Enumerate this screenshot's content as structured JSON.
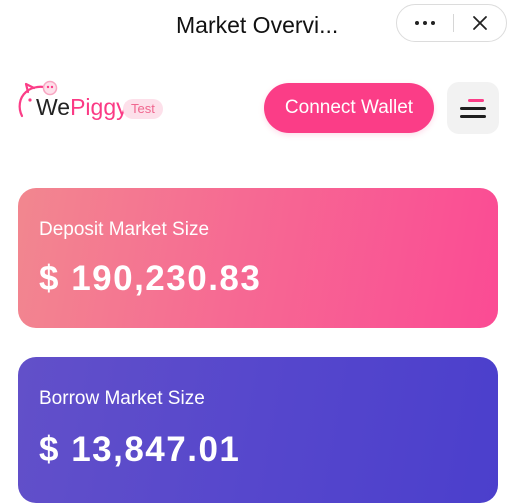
{
  "titlebar": {
    "title": "Market Overvi...",
    "more_icon": "more-dots-icon",
    "close_icon": "close-icon"
  },
  "header": {
    "logo": {
      "we": "We",
      "piggy": "Piggy",
      "badge": "Test"
    },
    "connect_label": "Connect Wallet",
    "menu_icon": "hamburger-menu-icon"
  },
  "markets": {
    "deposit": {
      "label": "Deposit Market Size",
      "value": "$ 190,230.83"
    },
    "borrow": {
      "label": "Borrow Market Size",
      "value": "$ 13,847.01"
    }
  },
  "colors": {
    "brand_pink": "#fb3d87",
    "deposit_gradient_start": "#f2878f",
    "deposit_gradient_end": "#fb4b94",
    "borrow_gradient_start": "#6250c9",
    "borrow_gradient_end": "#4b3fcc",
    "badge_bg": "#fde0ea"
  }
}
